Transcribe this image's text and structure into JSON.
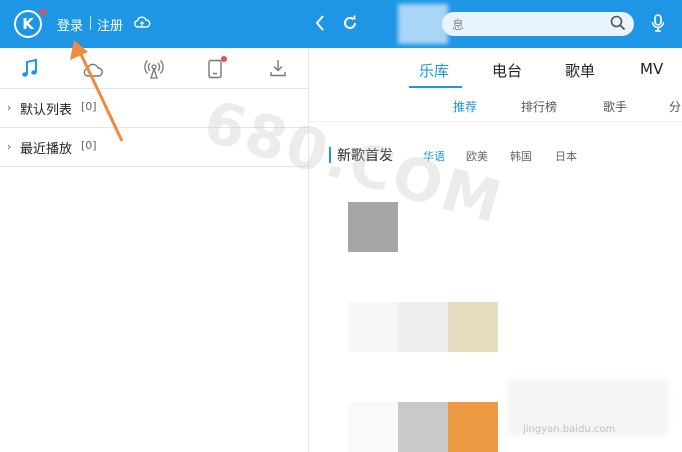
{
  "header": {
    "logo_letter": "K",
    "login_label": "登录",
    "register_label": "注册",
    "search_placeholder": "",
    "search_hint_char": "息"
  },
  "left_panel": {
    "tabs": [
      "music-note-icon",
      "cloud-icon",
      "radio-icon",
      "device-icon",
      "download-icon"
    ],
    "lists": [
      {
        "name": "默认列表",
        "count": "[0]"
      },
      {
        "name": "最近播放",
        "count": "[0]"
      }
    ]
  },
  "main": {
    "tabs": [
      "乐库",
      "电台",
      "歌单",
      "MV"
    ],
    "active_tab": "乐库",
    "subtabs": [
      "推荐",
      "排行榜",
      "歌手",
      "分"
    ],
    "active_subtab": "推荐",
    "section_title": "新歌首发",
    "regions": [
      "华语",
      "欧美",
      "韩国",
      "日本"
    ],
    "active_region": "华语"
  },
  "watermark": "680.COM",
  "site_watermark": "jingyan.baidu.com",
  "colors": {
    "accent": "#1f95e6",
    "annotation_arrow": "#f08a3c",
    "notify_dot": "#f04a4a"
  }
}
